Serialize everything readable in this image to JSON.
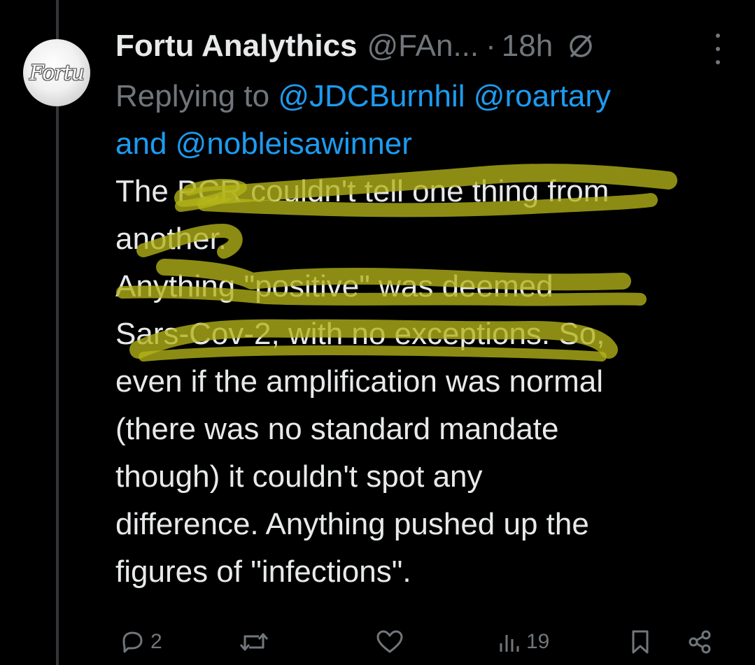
{
  "tweet": {
    "display_name": "Fortu Analythics",
    "handle": "@FAn...",
    "separator": "·",
    "time": "18h",
    "avatar_text": "Fortu",
    "reply_context": {
      "prefix": "Replying to",
      "mention_1": "@JDCBurnhil",
      "mention_2": "@roartary",
      "conjunction": "and",
      "mention_3": "@nobleisawinner"
    },
    "body_lines": [
      "The PCR couldn't tell one thing from",
      "another.",
      "Anything \"positive\" was deemed",
      "Sars-Cov-2, with no exceptions. So,",
      "even if the amplification was normal",
      "(there was no standard mandate",
      "though) it couldn't spot any",
      "difference. Anything pushed up the",
      "figures of \"infections\"."
    ],
    "actions": {
      "reply_count": "2",
      "retweet_count": "",
      "like_count": "",
      "views_count": "19"
    }
  },
  "colors": {
    "background": "#000000",
    "text_primary": "#e7e9ea",
    "text_secondary": "#71767b",
    "link": "#1d9bf0",
    "highlighter": "#b3b31a"
  },
  "icons": {
    "avatar": "fortu-logo-avatar",
    "no_entry": "no-entry-icon",
    "more": "more-vertical-icon",
    "reply": "reply-icon",
    "retweet": "retweet-icon",
    "like": "heart-icon",
    "views": "views-bar-chart-icon",
    "bookmark": "bookmark-icon",
    "share": "share-icon"
  }
}
